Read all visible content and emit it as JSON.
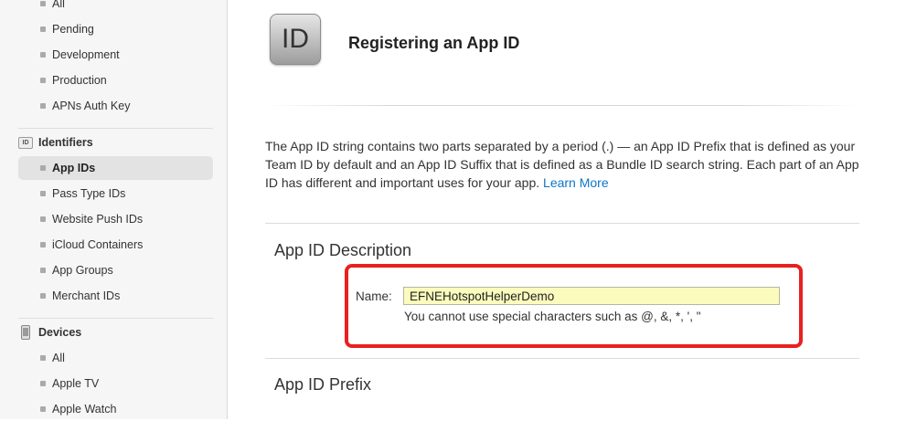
{
  "sidebar": {
    "group1": [
      "All",
      "Pending",
      "Development",
      "Production",
      "APNs Auth Key"
    ],
    "identifiers_title": "Identifiers",
    "identifiers_icon_text": "ID",
    "identifiers": [
      "App IDs",
      "Pass Type IDs",
      "Website Push IDs",
      "iCloud Containers",
      "App Groups",
      "Merchant IDs"
    ],
    "devices_title": "Devices",
    "devices": [
      "All",
      "Apple TV",
      "Apple Watch"
    ]
  },
  "header": {
    "icon_text": "ID",
    "title": "Registering an App ID"
  },
  "intro": {
    "text": "The App ID string contains two parts separated by a period (.) — an App ID Prefix that is defined as your Team ID by default and an App ID Suffix that is defined as a Bundle ID search string. Each part of an App ID has different and important uses for your app.",
    "link": "Learn More"
  },
  "description_section": {
    "title": "App ID Description",
    "name_label": "Name:",
    "name_value": "EFNEHotspotHelperDemo",
    "hint": "You cannot use special characters such as @, &, *, ', \""
  },
  "prefix_section": {
    "title": "App ID Prefix"
  },
  "colors": {
    "highlight": "#e8201f",
    "link": "#0b77c6",
    "input_bg": "#fbfbbd"
  }
}
